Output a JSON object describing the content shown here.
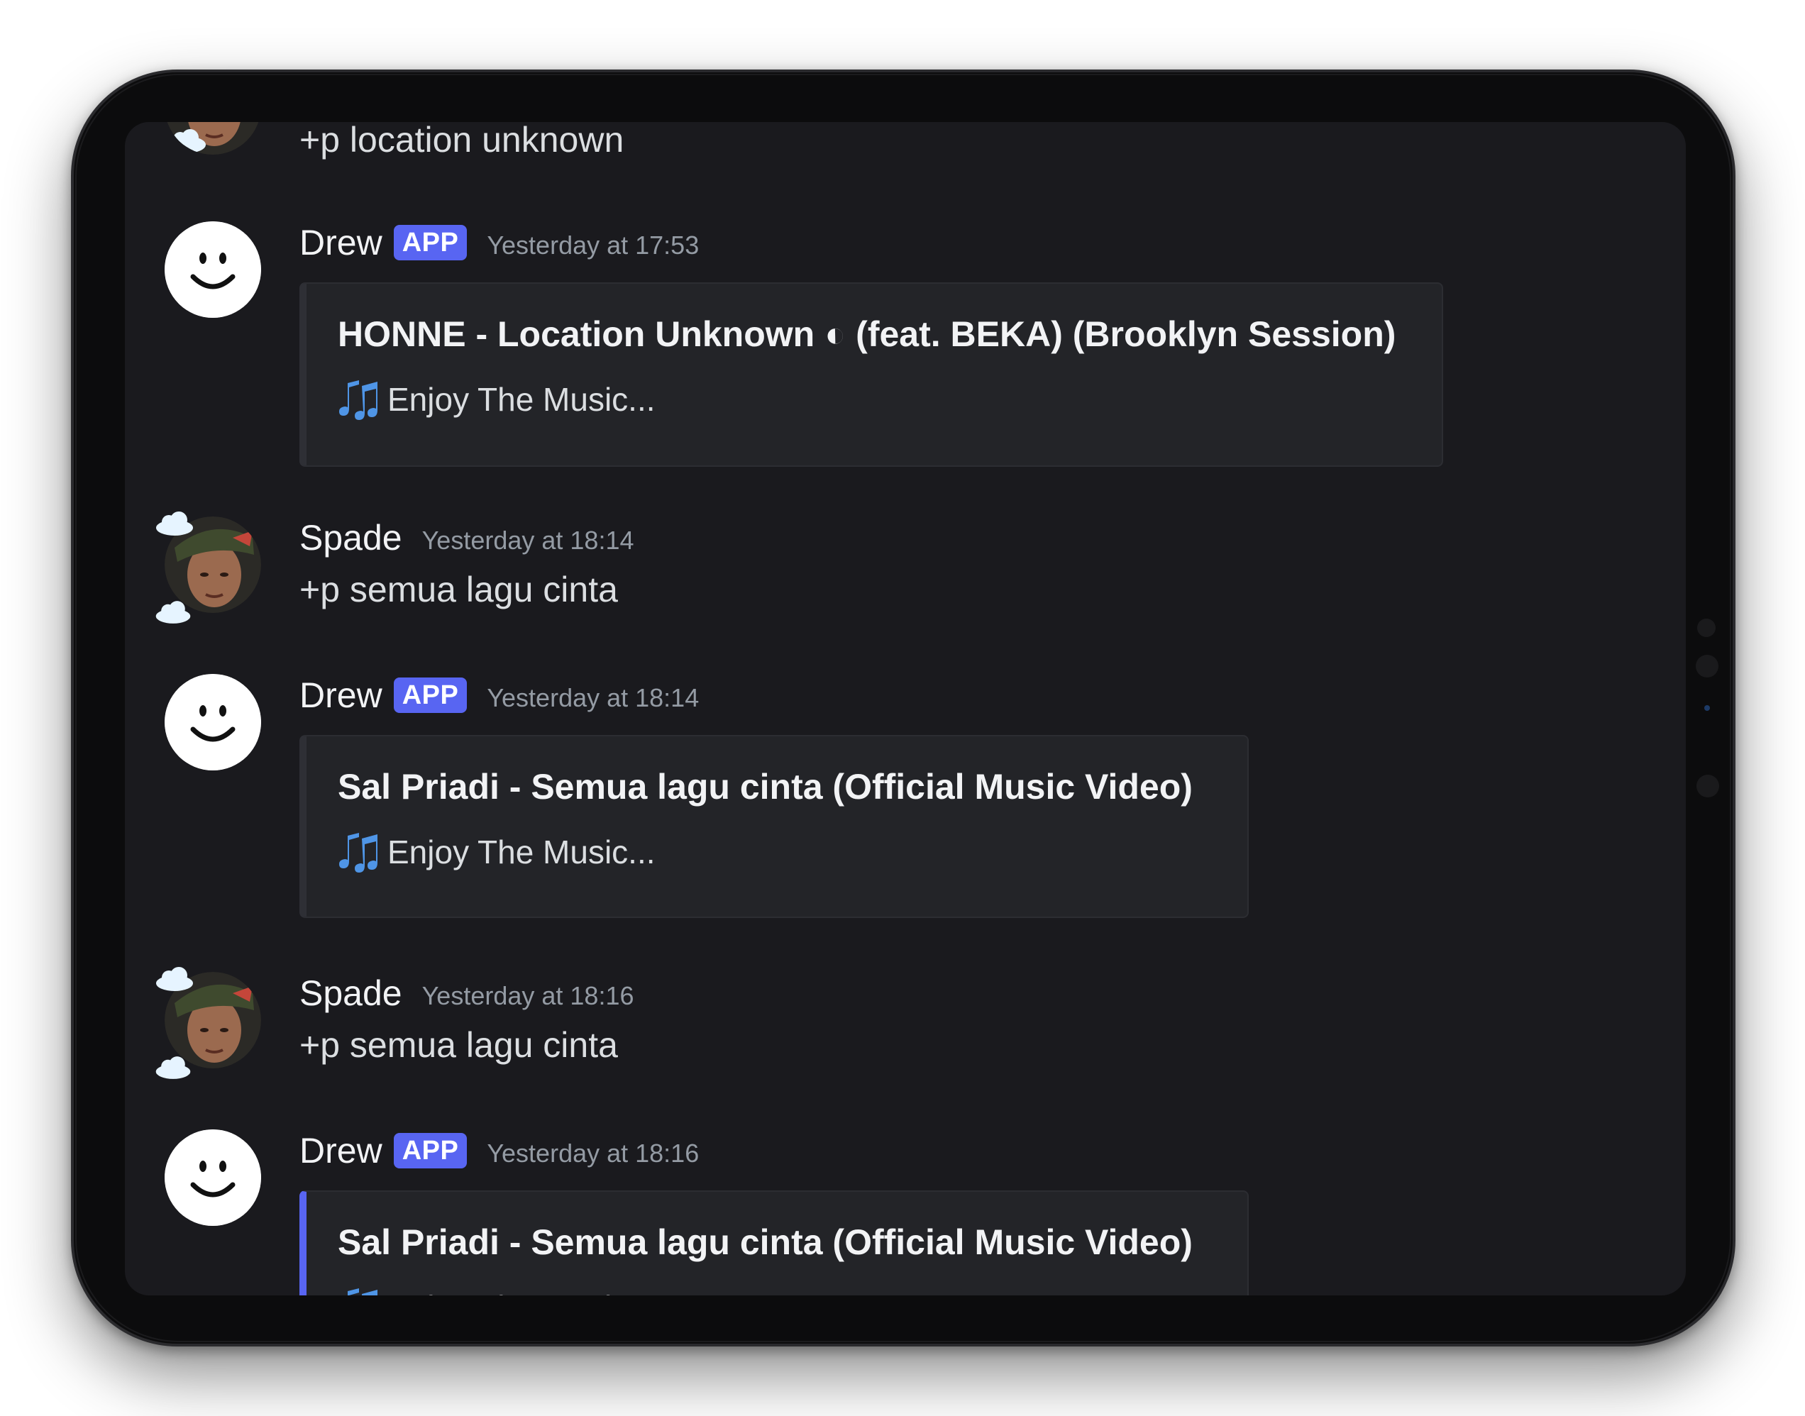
{
  "messages": [
    {
      "author": "Spade",
      "content": "+p location unknown",
      "continued": true
    },
    {
      "author": "Drew",
      "badge": "APP",
      "timestamp": "Yesterday at 17:53",
      "embed": {
        "title": "HONNE - Location Unknown ◐ (feat. BEKA) (Brooklyn Session)",
        "description": "Enjoy The Music..."
      }
    },
    {
      "author": "Spade",
      "timestamp": "Yesterday at 18:14",
      "content": "+p semua lagu cinta"
    },
    {
      "author": "Drew",
      "badge": "APP",
      "timestamp": "Yesterday at 18:14",
      "embed": {
        "title": "Sal Priadi -  Semua lagu cinta (Official Music Video)",
        "description": "Enjoy The Music..."
      }
    },
    {
      "author": "Spade",
      "timestamp": "Yesterday at 18:16",
      "content": "+p semua lagu cinta"
    },
    {
      "author": "Drew",
      "badge": "APP",
      "timestamp": "Yesterday at 18:16",
      "embed": {
        "title": "Sal Priadi -  Semua lagu cinta (Official Music Video)",
        "description": "Enjoy The Music..."
      }
    }
  ],
  "icons": {
    "bot_avatar": "smiley-face-icon",
    "user_avatar": "user-photo-avatar",
    "embed_desc": "musical-notes-icon"
  },
  "colors": {
    "background": "#1a1a1e",
    "embed_background": "#232428",
    "app_badge": "#5865f2",
    "embed_accent": "#5865f2",
    "timestamp": "#949ba4",
    "text": "#dbdee1"
  }
}
